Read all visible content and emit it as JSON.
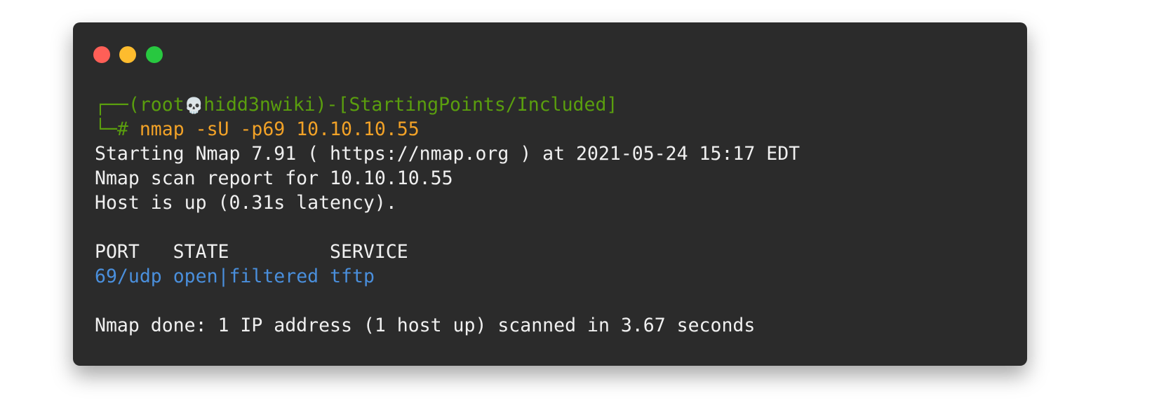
{
  "window": {
    "controls": [
      {
        "name": "close",
        "color": "#ff5f57"
      },
      {
        "name": "minimize",
        "color": "#febc2e"
      },
      {
        "name": "maximize",
        "color": "#28c840"
      }
    ]
  },
  "terminal": {
    "prompt": {
      "box_top": "┌──",
      "user": "(root",
      "skull_icon": "💀",
      "host": "hidd3nwiki)-[StartingPoints/Included]",
      "box_bottom": "└─",
      "symbol": "# ",
      "command": "nmap -sU -p69 10.10.10.55"
    },
    "output": {
      "start": "Starting Nmap 7.91 ( https://nmap.org ) at 2021-05-24 15:17 EDT",
      "report": "Nmap scan report for 10.10.10.55",
      "host_up": "Host is up (0.31s latency).",
      "table_header": "PORT   STATE         SERVICE",
      "table_rows": [
        {
          "port": "69/udp",
          "state": "open|filtered",
          "service": "tftp"
        }
      ],
      "done": "Nmap done: 1 IP address (1 host up) scanned in 3.67 seconds"
    },
    "colors": {
      "prompt": "#5a9e0e",
      "command": "#f2a227",
      "port_row": "#4a8fdc",
      "text": "#f0f0f0",
      "background": "#2b2b2b"
    }
  }
}
